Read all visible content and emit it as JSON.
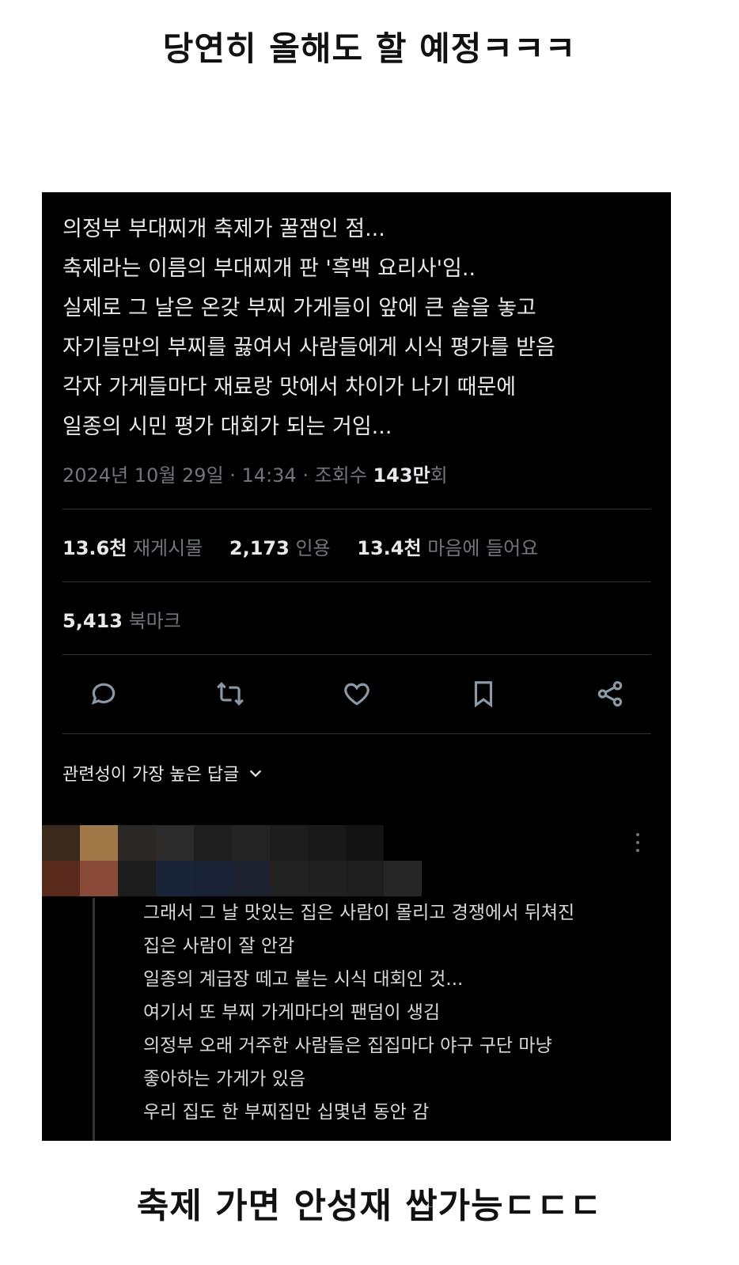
{
  "captions": {
    "top": "당연히 올해도 할 예정ㅋㅋㅋ",
    "bottom": "축제 가면 안성재 쌉가능ㄷㄷㄷ"
  },
  "tweet": {
    "lines": [
      "의정부 부대찌개 축제가 꿀잼인 점...",
      "축제라는 이름의 부대찌개 판 '흑백 요리사'임..",
      "실제로 그 날은 온갖 부찌 가게들이 앞에 큰 솥을 놓고",
      "자기들만의 부찌를 끓여서 사람들에게 시식 평가를 받음",
      "각자 가게들마다 재료랑 맛에서 차이가 나기 때문에",
      "일종의 시민 평가 대회가 되는 거임..."
    ],
    "timestamp": "2024년 10월 29일 · 14:34 · 조회수 ",
    "views": "143만",
    "views_suffix": "회"
  },
  "stats": {
    "reposts_num": "13.6천",
    "reposts_label": "재게시물",
    "quotes_num": "2,173",
    "quotes_label": "인용",
    "likes_num": "13.4천",
    "likes_label": "마음에 들어요",
    "bookmarks_num": "5,413",
    "bookmarks_label": "북마크"
  },
  "actions": [
    "reply-icon",
    "repost-icon",
    "like-icon",
    "bookmark-icon",
    "share-icon"
  ],
  "replies_sort": {
    "label": "관련성이 가장 높은 답글"
  },
  "reply": {
    "lines": [
      "그래서 그 날 맛있는 집은 사람이 몰리고 경쟁에서 뒤쳐진",
      "집은 사람이 잘 안감",
      "일종의 계급장 떼고 붙는 시식 대회인 것...",
      "여기서 또 부찌 가게마다의 팬덤이 생김",
      "의정부 오래 거주한 사람들은 집집마다 야구 구단 마냥",
      "좋아하는 가게가 있음",
      "우리 집도 한 부찌집만 십몇년 동안 감"
    ]
  },
  "colors": {
    "background": "#000000",
    "text": "#e7e9ea",
    "muted": "#71767b",
    "divider": "#2f3336"
  }
}
